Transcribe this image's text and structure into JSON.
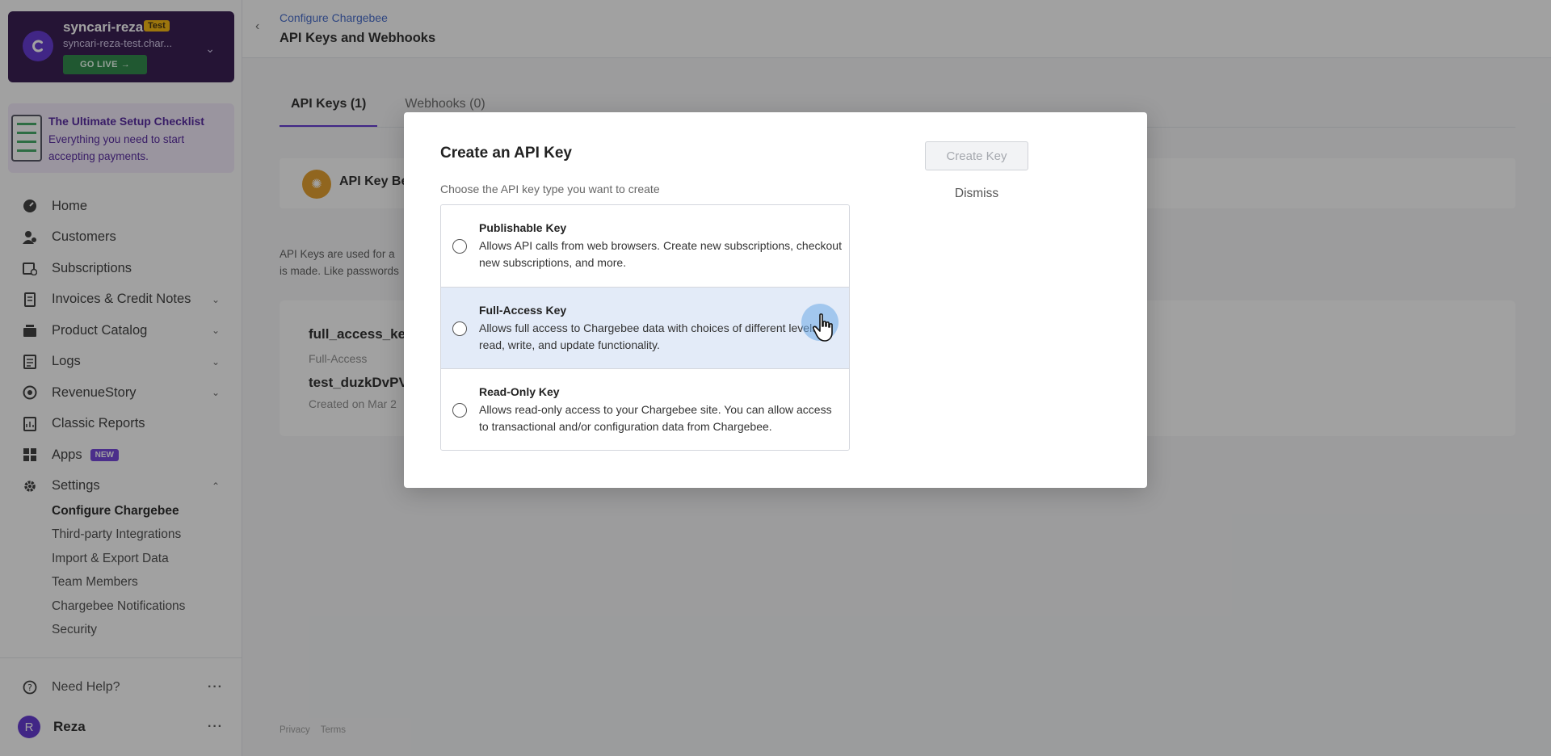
{
  "site": {
    "name": "syncari-reza",
    "badge": "Test",
    "url": "syncari-reza-test.char...",
    "go_live": "GO LIVE"
  },
  "checklist": {
    "title": "The Ultimate Setup Checklist",
    "desc": "Everything you need to start accepting payments."
  },
  "nav": {
    "home": "Home",
    "customers": "Customers",
    "subscriptions": "Subscriptions",
    "invoices": "Invoices & Credit Notes",
    "product_catalog": "Product Catalog",
    "logs": "Logs",
    "revenuestory": "RevenueStory",
    "classic_reports": "Classic Reports",
    "apps": "Apps",
    "apps_badge": "NEW",
    "settings": "Settings",
    "sub_items": [
      "Configure Chargebee",
      "Third-party Integrations",
      "Import & Export Data",
      "Team Members",
      "Chargebee Notifications",
      "Security"
    ],
    "help": "Need Help?",
    "user_initial": "R",
    "user_name": "Reza"
  },
  "header": {
    "breadcrumb": "Configure Chargebee",
    "title": "API Keys and Webhooks"
  },
  "tabs": [
    "API Keys (1)",
    "Webhooks (0)"
  ],
  "banner": {
    "text": "API Key Be"
  },
  "description": {
    "line1": "API Keys are used for a",
    "line2": "is made. Like passwords"
  },
  "key_card": {
    "name": "full_access_key",
    "type": "Full-Access",
    "value": "test_duzkDvPV",
    "created": "Created on Mar 2"
  },
  "footer": {
    "privacy": "Privacy",
    "terms": "Terms"
  },
  "modal": {
    "title": "Create an API Key",
    "subtitle": "Choose the API key type you want to create",
    "create_button": "Create Key",
    "dismiss_button": "Dismiss",
    "options": [
      {
        "title": "Publishable Key",
        "desc": "Allows API calls from web browsers. Create new subscriptions, checkout new subscriptions, and more."
      },
      {
        "title": "Full-Access Key",
        "desc": "Allows full access to Chargebee data with choices of different levels of read, write, and update functionality."
      },
      {
        "title": "Read-Only Key",
        "desc": "Allows read-only access to your Chargebee site. You can allow access to transactional and/or configuration data from Chargebee."
      }
    ]
  },
  "colors": {
    "brand_purple": "#5b2bd0",
    "site_card_bg": "#2a0d45",
    "go_live_green": "#22823e",
    "hover_row": "#e3ebf8"
  }
}
